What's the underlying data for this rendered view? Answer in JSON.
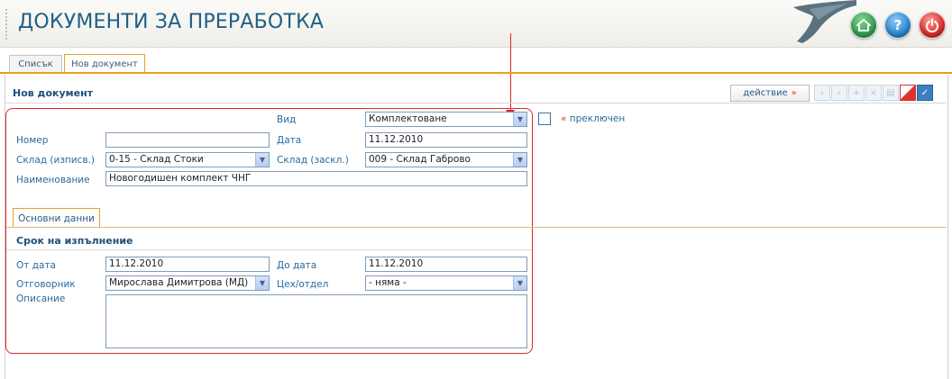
{
  "app": {
    "title": "ДОКУМЕНТИ ЗА ПРЕРАБОТКА",
    "header_buttons": [
      {
        "name": "home",
        "icon": "home-icon",
        "color": "#3aa35a"
      },
      {
        "name": "help",
        "icon": "question-icon",
        "symbol": "?",
        "color": "#2f8ed8"
      },
      {
        "name": "power",
        "icon": "power-icon",
        "color": "#e0312e"
      }
    ]
  },
  "tabs": [
    {
      "label": "Списък",
      "active": false
    },
    {
      "label": "Нов документ",
      "active": true
    }
  ],
  "section": {
    "title": "Нов документ",
    "action_label": "действие",
    "action_suffix": "»",
    "toolbar_icons": [
      "prev-icon",
      "next-icon",
      "add-icon",
      "delete-icon",
      "print-icon",
      "cancel-icon",
      "save-icon"
    ]
  },
  "form": {
    "vid_label": "Вид",
    "vid_value": "Комплектоване",
    "switched_label": "преключен",
    "switched_prefix": "«",
    "nomer_label": "Номер",
    "nomer_value": "",
    "data_label": "Дата",
    "data_value": "11.12.2010",
    "sklad_out_label": "Склад (изписв.)",
    "sklad_out_value": "0-15 - Склад Стоки",
    "sklad_in_label": "Склад (заскл.)",
    "sklad_in_value": "009 - Склад Габрово",
    "name_label": "Наименование",
    "name_value": "Новогодишен комплект ЧНГ"
  },
  "subtab": {
    "label": "Основни данни"
  },
  "term": {
    "title": "Срок на изпълнение",
    "from_label": "От дата",
    "from_value": "11.12.2010",
    "to_label": "До дата",
    "to_value": "11.12.2010",
    "resp_label": "Отговорник",
    "resp_value": "Мирослава Димитрова (МД)",
    "dept_label": "Цех/отдел",
    "dept_value": "- няма -",
    "desc_label": "Описание",
    "desc_value": ""
  },
  "colors": {
    "accent": "#e6a21e",
    "highlight": "#e0252a",
    "title": "#1f5f86"
  }
}
